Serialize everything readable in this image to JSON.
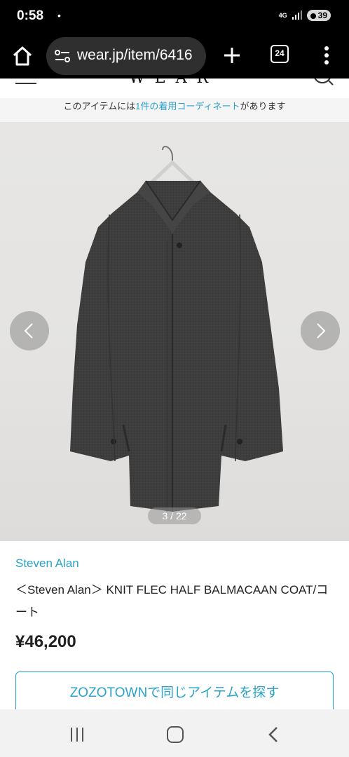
{
  "status_bar": {
    "time": "0:58",
    "dot": "•",
    "network": "4G",
    "battery": "39"
  },
  "browser": {
    "url": "wear.jp/item/6416",
    "tab_count": "24",
    "icons": [
      "home-icon",
      "site-info-icon",
      "new-tab-icon",
      "tabs-icon",
      "more-menu-icon"
    ]
  },
  "site": {
    "logo": "WEAR",
    "coord_banner": {
      "prefix": "このアイテムには",
      "link": "1件の着用コーディネート",
      "suffix": "があります"
    }
  },
  "gallery": {
    "counter": "3 / 22"
  },
  "product": {
    "brand": "Steven Alan",
    "title": "＜Steven Alan＞ KNIT FLEC HALF BALMACAAN COAT/コート",
    "price": "¥46,200",
    "zozo_button": "ZOZOTOWNで同じアイテムを探す"
  },
  "colors": {
    "accent": "#2aa2c9",
    "coat": "#3b3b3b"
  }
}
